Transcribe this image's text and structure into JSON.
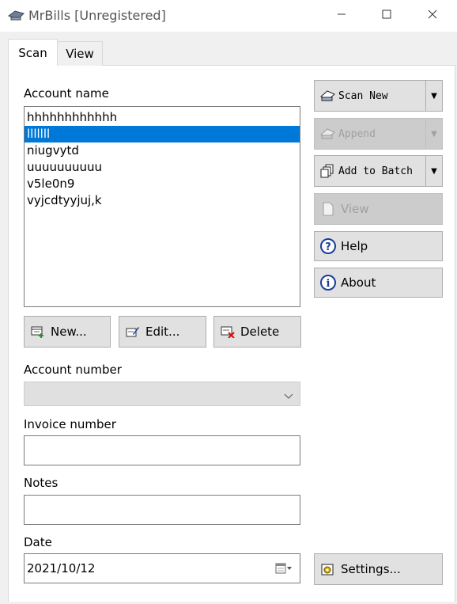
{
  "window": {
    "title": "MrBills [Unregistered]",
    "icons": {
      "app": "scanner-icon",
      "minimize": "minimize-icon",
      "maximize": "maximize-icon",
      "close": "close-icon"
    }
  },
  "tabs": [
    {
      "label": "Scan",
      "active": true
    },
    {
      "label": "View",
      "active": false
    }
  ],
  "account_name": {
    "label": "Account name",
    "items": [
      "hhhhhhhhhhhh",
      "lllllll",
      "niugvytd",
      "uuuuuuuuuu",
      "v5le0n9",
      "vyjcdtyyjuj,k"
    ],
    "selected_index": 1
  },
  "list_buttons": {
    "new": {
      "label": "New...",
      "icon": "new-account-icon"
    },
    "edit": {
      "label": "Edit...",
      "icon": "edit-account-icon"
    },
    "delete": {
      "label": "Delete",
      "icon": "delete-account-icon"
    }
  },
  "account_number": {
    "label": "Account number",
    "value": ""
  },
  "invoice_number": {
    "label": "Invoice number",
    "value": ""
  },
  "notes": {
    "label": "Notes",
    "value": ""
  },
  "date": {
    "label": "Date",
    "value": "2021/10/12"
  },
  "actions": {
    "scan_new": {
      "label": "Scan New",
      "enabled": true,
      "icon": "scan-icon"
    },
    "append": {
      "label": "Append",
      "enabled": false,
      "icon": "append-icon"
    },
    "add_to_batch": {
      "label": "Add to Batch",
      "enabled": true,
      "icon": "batch-icon"
    },
    "view": {
      "label": "View",
      "enabled": false,
      "icon": "document-icon"
    },
    "help": {
      "label": "Help",
      "enabled": true,
      "icon": "help-icon"
    },
    "about": {
      "label": "About",
      "enabled": true,
      "icon": "info-icon"
    },
    "settings": {
      "label": "Settings...",
      "enabled": true,
      "icon": "settings-icon"
    }
  },
  "colors": {
    "selection": "#0078d7",
    "button_face": "#e1e1e1",
    "frame": "#f0f0f0"
  }
}
